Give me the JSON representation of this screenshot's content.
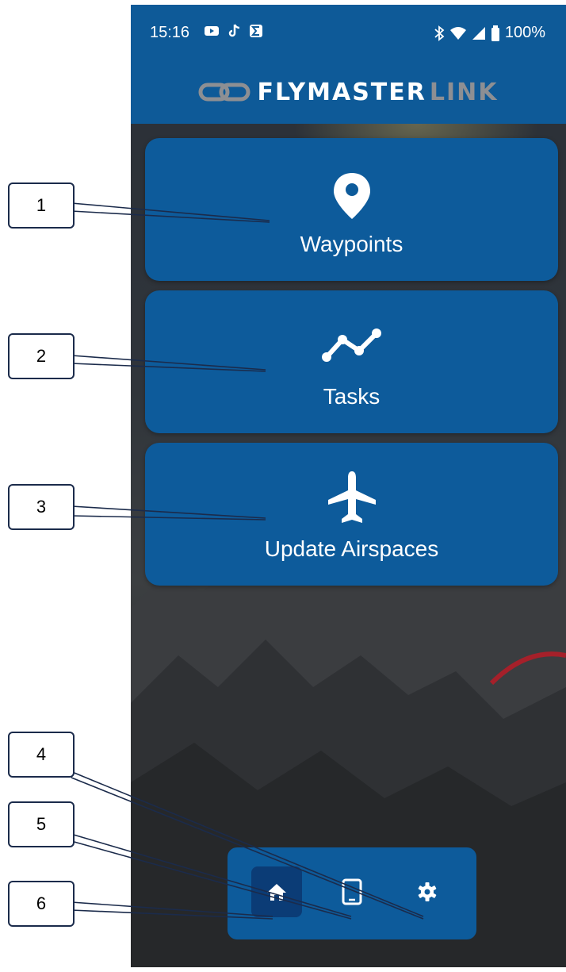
{
  "status_bar": {
    "time": "15:16",
    "battery": "100%",
    "notification_icons": [
      "youtube-icon",
      "tiktok-icon",
      "sigma-icon"
    ],
    "system_icons": [
      "bluetooth-icon",
      "wifi-icon",
      "signal-icon",
      "battery-icon"
    ]
  },
  "header": {
    "logo_part1": "FLYMASTER",
    "logo_part2": "LINK"
  },
  "menu": {
    "items": [
      {
        "label": "Waypoints",
        "icon": "location-pin-icon"
      },
      {
        "label": "Tasks",
        "icon": "route-line-icon"
      },
      {
        "label": "Update Airspaces",
        "icon": "airplane-icon"
      }
    ]
  },
  "bottom_nav": {
    "items": [
      {
        "icon": "home-icon",
        "active": true
      },
      {
        "icon": "device-icon",
        "active": false
      },
      {
        "icon": "gear-icon",
        "active": false
      }
    ]
  },
  "callouts": [
    "1",
    "2",
    "3",
    "4",
    "5",
    "6"
  ],
  "colors": {
    "primary": "#0d5b9b",
    "active_nav": "#0b3c76",
    "logo_accent": "#8d8f93"
  }
}
